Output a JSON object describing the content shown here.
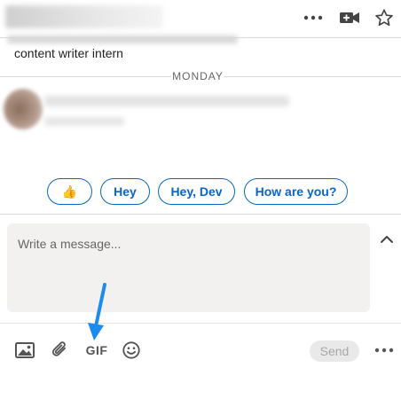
{
  "message": {
    "visible_text": "content writer intern"
  },
  "divider": {
    "label": "MONDAY"
  },
  "quick_replies": [
    {
      "label": "👍"
    },
    {
      "label": "Hey"
    },
    {
      "label": "Hey, Dev"
    },
    {
      "label": "How are you?"
    }
  ],
  "compose": {
    "placeholder": "Write a message..."
  },
  "toolbar": {
    "gif_label": "GIF",
    "send_label": "Send"
  },
  "colors": {
    "accent": "#0a66c2",
    "annotation_arrow": "#1a8cf0",
    "compose_bg": "#f3f1ef"
  },
  "icons": {
    "header": [
      "more-options-icon",
      "video-call-icon",
      "star-icon"
    ],
    "compose": [
      "collapse-chevron-icon"
    ],
    "toolbar": [
      "image-icon",
      "attachment-icon",
      "gif-icon",
      "emoji-icon",
      "more-options-icon"
    ]
  }
}
